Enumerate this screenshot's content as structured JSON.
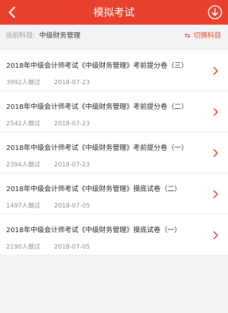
{
  "header": {
    "title": "模拟考试",
    "back_icon": "back-arrow-icon",
    "download_icon": "download-icon",
    "background_color": "#e8412e"
  },
  "subject": {
    "label": "当前科目:",
    "value": "中级财务管理",
    "switch_label": "切换科目",
    "switch_icon": "swap-arrows-icon"
  },
  "exams": [
    {
      "title": "2018年中级会计师考试《中级财务管理》考前提分卷（三）",
      "count": "3992人做过",
      "date": "2018-07-23"
    },
    {
      "title": "2018年中级会计师考试《中级财务管理》考前提分卷（二）",
      "count": "2542人做过",
      "date": "2018-07-23"
    },
    {
      "title": "2018年中级会计师考试《中级财务管理》考前提分卷（一）",
      "count": "2394人做过",
      "date": "2018-07-23"
    },
    {
      "title": "2018年中级会计师考试《中级财务管理》摸底试卷（二）",
      "count": "1497人做过",
      "date": "2018-07-05"
    },
    {
      "title": "2018年中级会计师考试《中级财务管理》摸底试卷（一）",
      "count": "2190人做过",
      "date": "2018-07-05"
    }
  ]
}
